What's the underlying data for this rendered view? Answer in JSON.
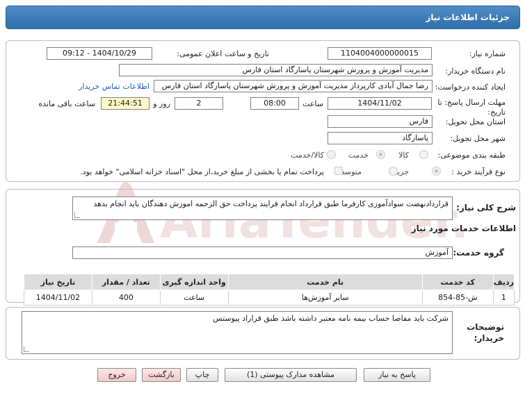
{
  "window": {
    "title": "جزئیات اطلاعات نیاز"
  },
  "fields": {
    "need_number_label": "شماره نیاز:",
    "need_number": "1104004000000015",
    "announce_label": "تاریخ و ساعت اعلان عمومی:",
    "announce_value": "1404/10/29 - 09:12",
    "buyer_org_label": "نام دستگاه خریدار:",
    "buyer_org": "مدیریت آموزش و پرورش شهرستان پاسارگاد استان فارس",
    "requester_label": "ایجاد کننده درخواست:",
    "requester": "رضا جمال آبادی کارپرداز مدیریت آموزش و پرورش شهرستان پاسارگاد استان فارس",
    "contact_link": "اطلاعات تماس خریدار",
    "deadline_label": "مهلت ارسال پاسخ: تا تاریخ:",
    "deadline_date": "1404/11/02",
    "time_label": "ساعت",
    "deadline_time": "08:00",
    "day_label": "روز و",
    "days": "2",
    "remaining_time": "21:44:51",
    "remaining_label": "ساعت باقی مانده",
    "province_label": "استان محل تحویل:",
    "province": "فارس",
    "city_label": "شهر محل تحویل:",
    "city": "پاسارگاد",
    "category_label": "طبقه بندی موضوعی:",
    "category_options": [
      "کالا",
      "خدمت",
      "کالا/خدمت"
    ],
    "process_label": "نوع فرآیند خرید :",
    "process_options": [
      "جزیی",
      "متوسط"
    ],
    "payment_note": "پرداخت تمام یا بخشی از مبلغ خرید،از محل \"اسناد خزانه اسلامی\" خواهد بود."
  },
  "description": {
    "label": "شرح کلی نیاز:",
    "text": "قراردادنهضت سوادآموزی کارفرما طبق قرارداد انجام فرایند پرداخت حق الزحمه اموزش دهندگان باید انجام بدهد"
  },
  "services": {
    "section_title": "اطلاعات خدمات مورد نیاز",
    "group_label": "گروه خدمت:",
    "group_value": "آموزش",
    "columns": [
      "ردیف",
      "کد خدمت",
      "نام خدمت",
      "واحد اندازه گیری",
      "تعداد / مقدار",
      "تاریخ نیاز"
    ],
    "rows": [
      [
        "1",
        "ش-85-854",
        "سایر آموزش‌ها",
        "ساعت",
        "400",
        "1404/11/02"
      ]
    ]
  },
  "buyer_notes": {
    "label": "توضیحات خریدار:",
    "text": "شرکت باید مفاصا حساب بیمه نامه معتبر داشته باشد طبق قراراد پیوستس"
  },
  "buttons": {
    "reply": "پاسخ به نیاز",
    "attachments": "مشاهده مدارک پیوستی (1)",
    "print": "چاپ",
    "back": "بازگشت",
    "exit": "خروج"
  },
  "watermark": {
    "text": "AriaTender.net"
  },
  "colors": {
    "header": "#3a7ab8",
    "link": "#1a5fc2",
    "highlight": "#fefbc8",
    "watermark": "#e9c9c9"
  }
}
